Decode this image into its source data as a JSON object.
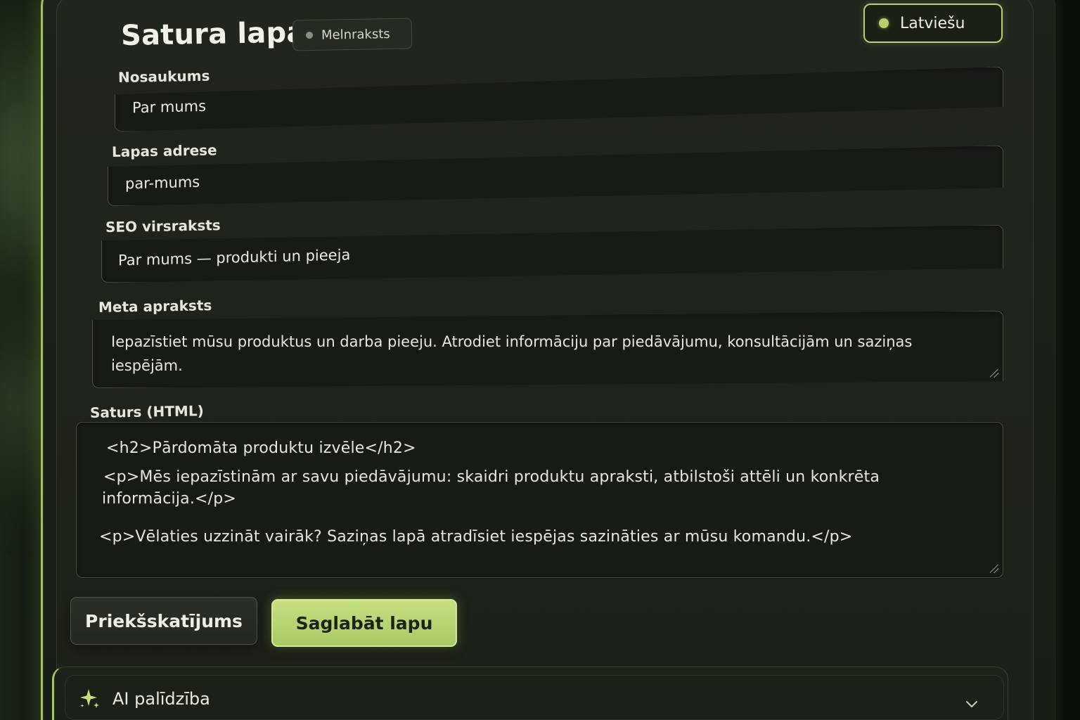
{
  "header": {
    "title": "Satura lapa",
    "status": "Melnraksts",
    "language": "Latviešu"
  },
  "fields": {
    "name": {
      "label": "Nosaukums",
      "value": "Par mums"
    },
    "slug": {
      "label": "Lapas adrese",
      "value": "par-mums"
    },
    "seo_title": {
      "label": "SEO virsraksts",
      "value": "Par mums — produkti un pieeja"
    },
    "meta_description": {
      "label": "Meta apraksts",
      "value": "Iepazīstiet mūsu produktus un darba pieeju. Atrodiet informāciju par piedāvājumu, konsultācijām un saziņas iespējām."
    },
    "content_html": {
      "label": "Saturs (HTML)",
      "lines": [
        "<h2>Pārdomāta produktu izvēle</h2>",
        "<p>Mēs iepazīstinām ar savu piedāvājumu: skaidri produktu apraksti, atbilstoši attēli un konkrēta",
        "informācija.</p>",
        "<p>Vēlaties uzzināt vairāk? Saziņas lapā atradīsiet iespējas sazināties ar mūsu komandu.</p>"
      ]
    }
  },
  "actions": {
    "preview_label": "Priekšskatījums",
    "save_label": "Saglabāt lapu"
  },
  "ai_panel": {
    "title": "AI palīdzība",
    "icon": "sparkle-icon",
    "toggle_icon": "chevron-down-icon"
  },
  "colors": {
    "accent": "#b5d36a",
    "primary_button": "#b8d574",
    "background": "#1c2119",
    "status_dot": "#8a8f85"
  }
}
